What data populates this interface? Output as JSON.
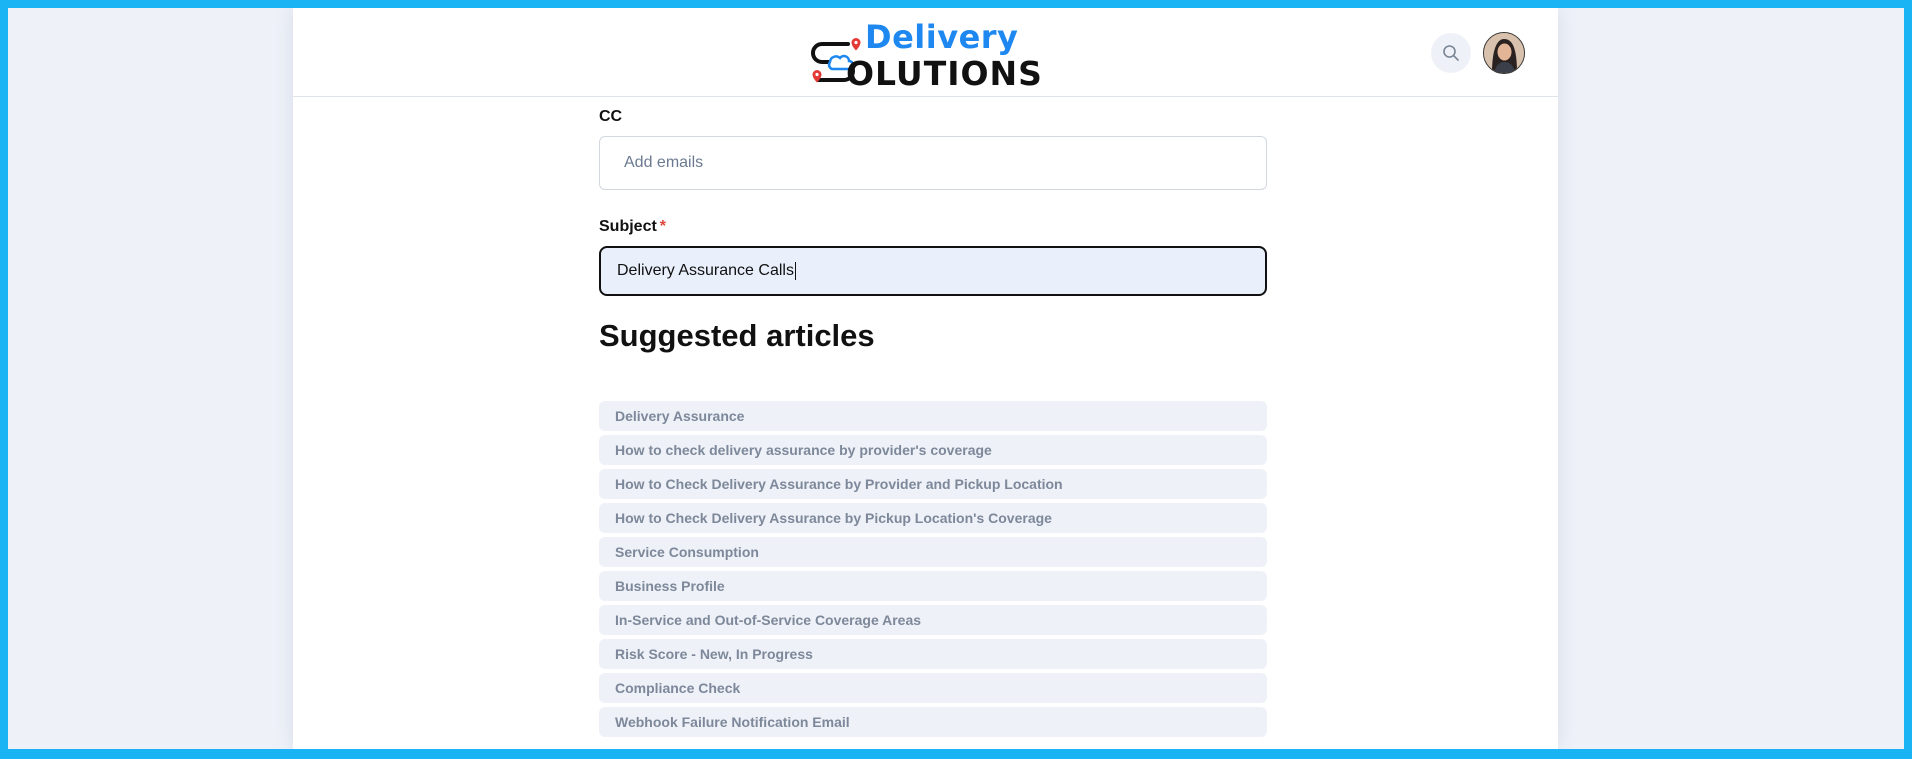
{
  "header": {
    "logo_top": "Delivery",
    "logo_bottom": "OLUTIONS",
    "search_icon": "search-icon",
    "avatar": "user-avatar"
  },
  "form": {
    "cc_label": "CC",
    "cc_placeholder": "Add emails",
    "subject_label": "Subject",
    "subject_required": "*",
    "subject_value": "Delivery Assurance Calls"
  },
  "suggested": {
    "title": "Suggested articles",
    "articles": [
      "Delivery Assurance",
      "How to check delivery assurance by provider's coverage",
      "How to Check Delivery Assurance by Provider and Pickup Location",
      "How to Check Delivery Assurance by Pickup Location's Coverage",
      "Service Consumption",
      "Business Profile",
      "In-Service and Out-of-Service Coverage Areas",
      "Risk Score - New, In Progress",
      "Compliance Check",
      "Webhook Failure Notification Email"
    ]
  },
  "colors": {
    "frame": "#1ab4f4",
    "brand_blue": "#1e88f0",
    "pin_red": "#e53935",
    "input_focus_bg": "#e9f0fc"
  }
}
